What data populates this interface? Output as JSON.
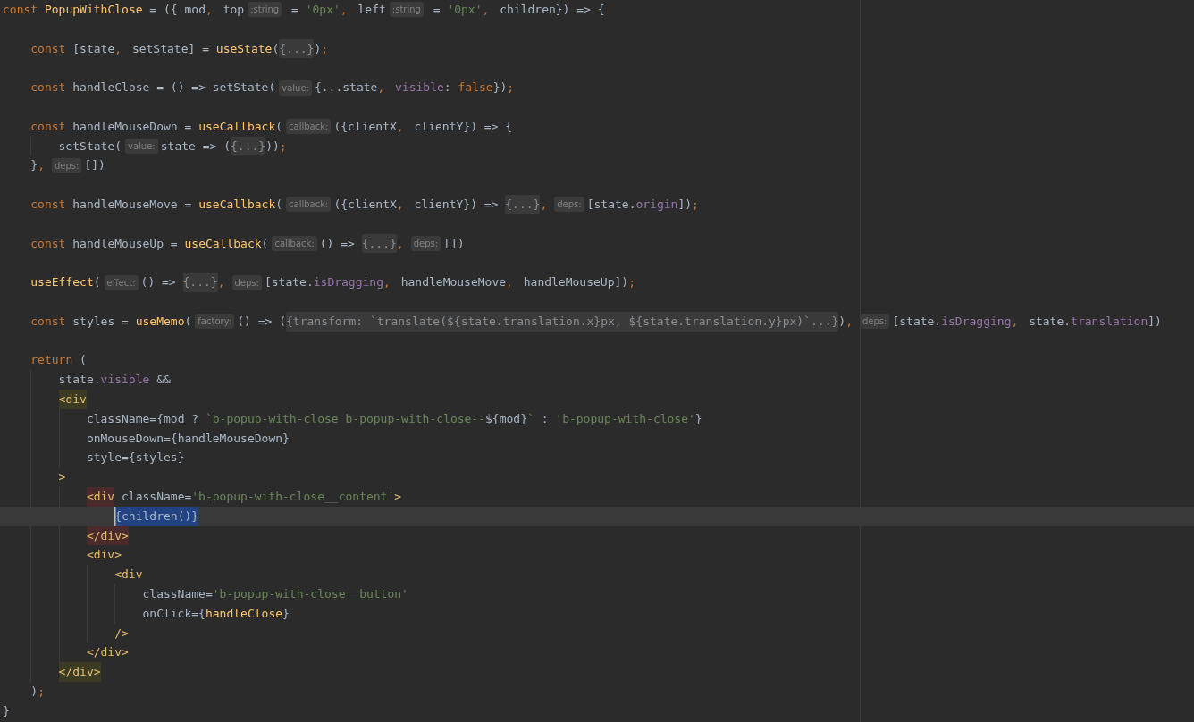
{
  "editor": {
    "lines": [
      {
        "tokens": [
          {
            "kind": "keyword",
            "text": "const"
          },
          {
            "kind": "fn",
            "text": " PopupWithClose"
          },
          {
            "kind": "text",
            "text": " = ({ mod"
          },
          {
            "kind": "punct",
            "text": ","
          },
          {
            "kind": "text",
            "text": " top"
          },
          {
            "kind": "hint",
            "text": ":string"
          },
          {
            "kind": "text",
            "text": " = "
          },
          {
            "kind": "str",
            "text": "'0px'"
          },
          {
            "kind": "punct",
            "text": ","
          },
          {
            "kind": "text",
            "text": " left"
          },
          {
            "kind": "hint",
            "text": ":string"
          },
          {
            "kind": "text",
            "text": " = "
          },
          {
            "kind": "str",
            "text": "'0px'"
          },
          {
            "kind": "punct",
            "text": ","
          },
          {
            "kind": "text",
            "text": " children}) => {"
          }
        ]
      },
      {
        "gap_before": true,
        "tokens": [
          {
            "kind": "keyword",
            "text": "    const"
          },
          {
            "kind": "text",
            "text": " [state"
          },
          {
            "kind": "punct",
            "text": ","
          },
          {
            "kind": "text",
            "text": " setState] = "
          },
          {
            "kind": "fn",
            "text": "useState"
          },
          {
            "kind": "text",
            "text": "("
          },
          {
            "kind": "fold",
            "text": "{...}"
          },
          {
            "kind": "text",
            "text": ")"
          },
          {
            "kind": "punct",
            "text": ";"
          }
        ]
      },
      {
        "gap_before": true,
        "tokens": [
          {
            "kind": "keyword",
            "text": "    const"
          },
          {
            "kind": "text",
            "text": " handleClose = () => setState("
          },
          {
            "kind": "hint",
            "text": "value:"
          },
          {
            "kind": "text",
            "text": "{...state"
          },
          {
            "kind": "punct",
            "text": ","
          },
          {
            "kind": "prop",
            "text": " visible"
          },
          {
            "kind": "text",
            "text": ": "
          },
          {
            "kind": "keyword",
            "text": "false"
          },
          {
            "kind": "text",
            "text": "})"
          },
          {
            "kind": "punct",
            "text": ";"
          }
        ]
      },
      {
        "gap_before": true,
        "tokens": [
          {
            "kind": "keyword",
            "text": "    const"
          },
          {
            "kind": "text",
            "text": " handleMouseDown = "
          },
          {
            "kind": "fn",
            "text": "useCallback"
          },
          {
            "kind": "text",
            "text": "("
          },
          {
            "kind": "hint",
            "text": "callback:"
          },
          {
            "kind": "text",
            "text": "({clientX"
          },
          {
            "kind": "punct",
            "text": ","
          },
          {
            "kind": "text",
            "text": " clientY}) => {"
          }
        ]
      },
      {
        "tokens": [
          {
            "kind": "text",
            "text": "        setState("
          },
          {
            "kind": "hint",
            "text": "value:"
          },
          {
            "kind": "text",
            "text": "state => ("
          },
          {
            "kind": "fold",
            "text": "{...}"
          },
          {
            "kind": "text",
            "text": "))"
          },
          {
            "kind": "punct",
            "text": ";"
          }
        ]
      },
      {
        "tokens": [
          {
            "kind": "text",
            "text": "    }"
          },
          {
            "kind": "punct",
            "text": ","
          },
          {
            "kind": "hint",
            "text": "deps:"
          },
          {
            "kind": "text",
            "text": "[])"
          }
        ]
      },
      {
        "gap_before": true,
        "tokens": [
          {
            "kind": "keyword",
            "text": "    const"
          },
          {
            "kind": "text",
            "text": " handleMouseMove = "
          },
          {
            "kind": "fn",
            "text": "useCallback"
          },
          {
            "kind": "text",
            "text": "("
          },
          {
            "kind": "hint",
            "text": "callback:"
          },
          {
            "kind": "text",
            "text": "({clientX"
          },
          {
            "kind": "punct",
            "text": ","
          },
          {
            "kind": "text",
            "text": " clientY}) => "
          },
          {
            "kind": "fold",
            "text": "{...}"
          },
          {
            "kind": "punct",
            "text": ","
          },
          {
            "kind": "hint",
            "text": "deps:"
          },
          {
            "kind": "text",
            "text": "[state."
          },
          {
            "kind": "prop",
            "text": "origin"
          },
          {
            "kind": "text",
            "text": "])"
          },
          {
            "kind": "punct",
            "text": ";"
          }
        ]
      },
      {
        "gap_before": true,
        "tokens": [
          {
            "kind": "keyword",
            "text": "    const"
          },
          {
            "kind": "text",
            "text": " handleMouseUp = "
          },
          {
            "kind": "fn",
            "text": "useCallback"
          },
          {
            "kind": "text",
            "text": "("
          },
          {
            "kind": "hint",
            "text": "callback:"
          },
          {
            "kind": "text",
            "text": "() => "
          },
          {
            "kind": "fold",
            "text": "{...}"
          },
          {
            "kind": "punct",
            "text": ","
          },
          {
            "kind": "hint",
            "text": "deps:"
          },
          {
            "kind": "text",
            "text": "[])"
          }
        ]
      },
      {
        "gap_before": true,
        "tokens": [
          {
            "kind": "fn",
            "text": "    useEffect"
          },
          {
            "kind": "text",
            "text": "("
          },
          {
            "kind": "hint",
            "text": "effect:"
          },
          {
            "kind": "text",
            "text": "() => "
          },
          {
            "kind": "fold",
            "text": "{...}"
          },
          {
            "kind": "punct",
            "text": ","
          },
          {
            "kind": "hint",
            "text": "deps:"
          },
          {
            "kind": "text",
            "text": "[state."
          },
          {
            "kind": "prop",
            "text": "isDragging"
          },
          {
            "kind": "punct",
            "text": ","
          },
          {
            "kind": "text",
            "text": " handleMouseMove"
          },
          {
            "kind": "punct",
            "text": ","
          },
          {
            "kind": "text",
            "text": " handleMouseUp])"
          },
          {
            "kind": "punct",
            "text": ";"
          }
        ]
      },
      {
        "gap_before": true,
        "tokens": [
          {
            "kind": "keyword",
            "text": "    const"
          },
          {
            "kind": "text",
            "text": " styles = "
          },
          {
            "kind": "fn",
            "text": "useMemo"
          },
          {
            "kind": "text",
            "text": "("
          },
          {
            "kind": "hint",
            "text": "factory:"
          },
          {
            "kind": "text",
            "text": "() => ("
          },
          {
            "kind": "fold",
            "text": "{transform: `translate(${state.translation.x}px, ${state.translation.y}px)`...}"
          },
          {
            "kind": "text",
            "text": ")"
          },
          {
            "kind": "punct",
            "text": ","
          },
          {
            "kind": "hint",
            "text": "deps:"
          },
          {
            "kind": "text",
            "text": "[state."
          },
          {
            "kind": "prop",
            "text": "isDragging"
          },
          {
            "kind": "punct",
            "text": ","
          },
          {
            "kind": "text",
            "text": " state."
          },
          {
            "kind": "prop",
            "text": "translation"
          },
          {
            "kind": "text",
            "text": "])"
          }
        ]
      },
      {
        "gap_before": true,
        "tokens": [
          {
            "kind": "keyword",
            "text": "    return"
          },
          {
            "kind": "text",
            "text": " ("
          }
        ]
      },
      {
        "tokens": [
          {
            "kind": "text",
            "text": "        state."
          },
          {
            "kind": "prop",
            "text": "visible"
          },
          {
            "kind": "text",
            "text": " &&"
          }
        ]
      },
      {
        "tokens": [
          {
            "kind": "tag-match",
            "text": "        <div"
          }
        ]
      },
      {
        "tokens": [
          {
            "kind": "text",
            "text": "            className={mod ? "
          },
          {
            "kind": "str",
            "text": "`b-popup-with-close b-popup-with-close--"
          },
          {
            "kind": "text",
            "text": "${mod}"
          },
          {
            "kind": "str",
            "text": "`"
          },
          {
            "kind": "text",
            "text": " : "
          },
          {
            "kind": "str",
            "text": "'b-popup-with-close'"
          },
          {
            "kind": "text",
            "text": "}"
          }
        ]
      },
      {
        "tokens": [
          {
            "kind": "text",
            "text": "            onMouseDown={handleMouseDown}"
          }
        ]
      },
      {
        "tokens": [
          {
            "kind": "text",
            "text": "            style={styles}"
          }
        ]
      },
      {
        "tokens": [
          {
            "kind": "tag",
            "text": "        >"
          }
        ]
      },
      {
        "tokens": [
          {
            "kind": "tag-unmatched",
            "text": "            <div"
          },
          {
            "kind": "text",
            "text": " className="
          },
          {
            "kind": "str",
            "text": "'b-popup-with-close__content'"
          },
          {
            "kind": "tag",
            "text": ">"
          }
        ]
      },
      {
        "current": true,
        "tokens": [
          {
            "kind": "selection",
            "text": "                {children()}"
          }
        ]
      },
      {
        "tokens": [
          {
            "kind": "tag-unmatched",
            "text": "            </div>"
          }
        ]
      },
      {
        "tokens": [
          {
            "kind": "tag",
            "text": "            <div>"
          }
        ]
      },
      {
        "tokens": [
          {
            "kind": "tag",
            "text": "                <div"
          }
        ]
      },
      {
        "tokens": [
          {
            "kind": "text",
            "text": "                    className="
          },
          {
            "kind": "str",
            "text": "'b-popup-with-close__button'"
          }
        ]
      },
      {
        "tokens": [
          {
            "kind": "text",
            "text": "                    onClick={"
          },
          {
            "kind": "fn",
            "text": "handleClose"
          },
          {
            "kind": "text",
            "text": "}"
          }
        ]
      },
      {
        "tokens": [
          {
            "kind": "tag",
            "text": "                />"
          }
        ]
      },
      {
        "tokens": [
          {
            "kind": "tag",
            "text": "            </div>"
          }
        ]
      },
      {
        "tokens": [
          {
            "kind": "tag-match",
            "text": "        </div>"
          }
        ]
      },
      {
        "tokens": [
          {
            "kind": "text",
            "text": "    )"
          },
          {
            "kind": "punct",
            "text": ";"
          }
        ]
      },
      {
        "tokens": [
          {
            "kind": "text",
            "text": "}"
          }
        ]
      }
    ]
  }
}
